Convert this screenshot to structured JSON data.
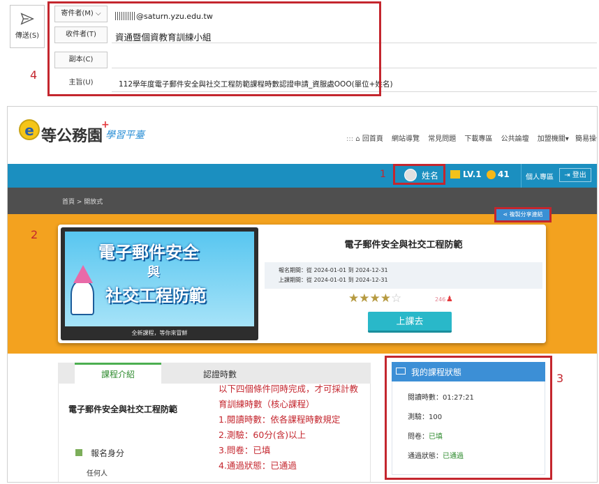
{
  "email": {
    "send_label": "傳送(S)",
    "from_label": "寄件者(M)",
    "from_value": "@saturn.yzu.edu.tw",
    "to_label": "收件者(T)",
    "to_value": "資通暨個資教育訓練小組",
    "cc_label": "副本(C)",
    "subject_label": "主旨(U)",
    "subject_value": "112學年度電子郵件安全與社交工程防範課程時數認證申請_資服處OOO(單位+姓名)",
    "annotation_number": "4"
  },
  "site": {
    "logo_main": "等公務園",
    "logo_sub": "學習平臺",
    "nav": [
      "回首頁",
      "網站導覽",
      "常見問題",
      "下載專區",
      "公共論壇",
      "加盟機關",
      "簡易操作"
    ],
    "user_name": "姓名",
    "level": "LV.1",
    "points": "41",
    "personal_area": "個人專區",
    "logout": "登出",
    "breadcrumb": "首頁 > 開放式",
    "share_button": "複製分享連結",
    "annotation_user": "1",
    "annotation_course": "2",
    "annotation_status": "3"
  },
  "course": {
    "banner_line1": "電子郵件安全",
    "banner_line2": "與",
    "banner_line3": "社交工程防範",
    "banner_caption": "全新課程，等你來冒鮮",
    "title": "電子郵件安全與社交工程防範",
    "enroll_period": "報名期間：從 2024-01-01 到 2024-12-31",
    "class_period": "上課期間：從 2024-01-01 到 2024-12-31",
    "rating_stars": 4,
    "rating_count": "246",
    "start_button": "上課去"
  },
  "tabs": {
    "intro": "課程介紹",
    "cert_hours": "認證時數"
  },
  "intro": {
    "course_name": "電子郵件安全與社交工程防範",
    "enroll_identity_heading": "報名身分",
    "enroll_identity_value": "任何人"
  },
  "conditions": [
    "以下四個條件同時完成，才可採計教",
    "育訓練時數（核心課程）",
    "1.閱讀時數：依各課程時數規定",
    "2.測驗：60分(含)以上",
    "3.問卷：已填",
    "4.通過狀態：已通過"
  ],
  "status": {
    "title": "我的課程狀態",
    "read_time_label": "閱讀時數：",
    "read_time_value": "01:27:21",
    "quiz_label": "測驗：",
    "quiz_value": "100",
    "survey_label": "問卷：",
    "survey_value": "已填",
    "pass_label": "通過狀態：",
    "pass_value": "已通過"
  },
  "colors": {
    "annotation_red": "#c4262e",
    "header_blue": "#1b8fc0",
    "orange_band": "#f3a21f",
    "enroll_teal": "#29b8c9",
    "status_green": "#2e8b2e"
  }
}
